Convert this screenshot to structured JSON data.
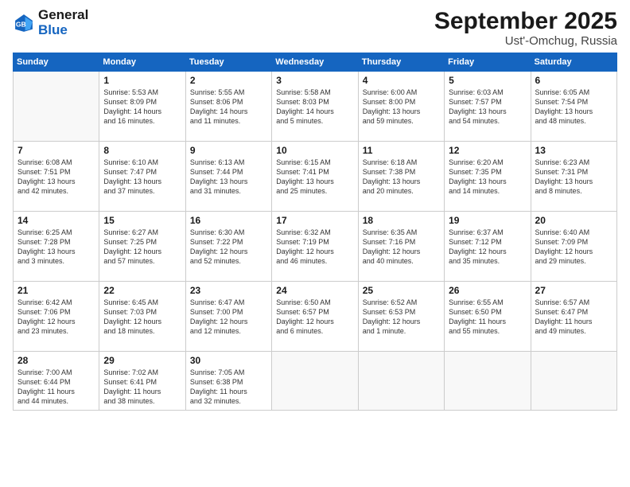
{
  "header": {
    "logo_line1": "General",
    "logo_line2": "Blue",
    "month_title": "September 2025",
    "location": "Ust'-Omchug, Russia"
  },
  "days_of_week": [
    "Sunday",
    "Monday",
    "Tuesday",
    "Wednesday",
    "Thursday",
    "Friday",
    "Saturday"
  ],
  "weeks": [
    [
      {
        "day": "",
        "info": ""
      },
      {
        "day": "1",
        "info": "Sunrise: 5:53 AM\nSunset: 8:09 PM\nDaylight: 14 hours\nand 16 minutes."
      },
      {
        "day": "2",
        "info": "Sunrise: 5:55 AM\nSunset: 8:06 PM\nDaylight: 14 hours\nand 11 minutes."
      },
      {
        "day": "3",
        "info": "Sunrise: 5:58 AM\nSunset: 8:03 PM\nDaylight: 14 hours\nand 5 minutes."
      },
      {
        "day": "4",
        "info": "Sunrise: 6:00 AM\nSunset: 8:00 PM\nDaylight: 13 hours\nand 59 minutes."
      },
      {
        "day": "5",
        "info": "Sunrise: 6:03 AM\nSunset: 7:57 PM\nDaylight: 13 hours\nand 54 minutes."
      },
      {
        "day": "6",
        "info": "Sunrise: 6:05 AM\nSunset: 7:54 PM\nDaylight: 13 hours\nand 48 minutes."
      }
    ],
    [
      {
        "day": "7",
        "info": "Sunrise: 6:08 AM\nSunset: 7:51 PM\nDaylight: 13 hours\nand 42 minutes."
      },
      {
        "day": "8",
        "info": "Sunrise: 6:10 AM\nSunset: 7:47 PM\nDaylight: 13 hours\nand 37 minutes."
      },
      {
        "day": "9",
        "info": "Sunrise: 6:13 AM\nSunset: 7:44 PM\nDaylight: 13 hours\nand 31 minutes."
      },
      {
        "day": "10",
        "info": "Sunrise: 6:15 AM\nSunset: 7:41 PM\nDaylight: 13 hours\nand 25 minutes."
      },
      {
        "day": "11",
        "info": "Sunrise: 6:18 AM\nSunset: 7:38 PM\nDaylight: 13 hours\nand 20 minutes."
      },
      {
        "day": "12",
        "info": "Sunrise: 6:20 AM\nSunset: 7:35 PM\nDaylight: 13 hours\nand 14 minutes."
      },
      {
        "day": "13",
        "info": "Sunrise: 6:23 AM\nSunset: 7:31 PM\nDaylight: 13 hours\nand 8 minutes."
      }
    ],
    [
      {
        "day": "14",
        "info": "Sunrise: 6:25 AM\nSunset: 7:28 PM\nDaylight: 13 hours\nand 3 minutes."
      },
      {
        "day": "15",
        "info": "Sunrise: 6:27 AM\nSunset: 7:25 PM\nDaylight: 12 hours\nand 57 minutes."
      },
      {
        "day": "16",
        "info": "Sunrise: 6:30 AM\nSunset: 7:22 PM\nDaylight: 12 hours\nand 52 minutes."
      },
      {
        "day": "17",
        "info": "Sunrise: 6:32 AM\nSunset: 7:19 PM\nDaylight: 12 hours\nand 46 minutes."
      },
      {
        "day": "18",
        "info": "Sunrise: 6:35 AM\nSunset: 7:16 PM\nDaylight: 12 hours\nand 40 minutes."
      },
      {
        "day": "19",
        "info": "Sunrise: 6:37 AM\nSunset: 7:12 PM\nDaylight: 12 hours\nand 35 minutes."
      },
      {
        "day": "20",
        "info": "Sunrise: 6:40 AM\nSunset: 7:09 PM\nDaylight: 12 hours\nand 29 minutes."
      }
    ],
    [
      {
        "day": "21",
        "info": "Sunrise: 6:42 AM\nSunset: 7:06 PM\nDaylight: 12 hours\nand 23 minutes."
      },
      {
        "day": "22",
        "info": "Sunrise: 6:45 AM\nSunset: 7:03 PM\nDaylight: 12 hours\nand 18 minutes."
      },
      {
        "day": "23",
        "info": "Sunrise: 6:47 AM\nSunset: 7:00 PM\nDaylight: 12 hours\nand 12 minutes."
      },
      {
        "day": "24",
        "info": "Sunrise: 6:50 AM\nSunset: 6:57 PM\nDaylight: 12 hours\nand 6 minutes."
      },
      {
        "day": "25",
        "info": "Sunrise: 6:52 AM\nSunset: 6:53 PM\nDaylight: 12 hours\nand 1 minute."
      },
      {
        "day": "26",
        "info": "Sunrise: 6:55 AM\nSunset: 6:50 PM\nDaylight: 11 hours\nand 55 minutes."
      },
      {
        "day": "27",
        "info": "Sunrise: 6:57 AM\nSunset: 6:47 PM\nDaylight: 11 hours\nand 49 minutes."
      }
    ],
    [
      {
        "day": "28",
        "info": "Sunrise: 7:00 AM\nSunset: 6:44 PM\nDaylight: 11 hours\nand 44 minutes."
      },
      {
        "day": "29",
        "info": "Sunrise: 7:02 AM\nSunset: 6:41 PM\nDaylight: 11 hours\nand 38 minutes."
      },
      {
        "day": "30",
        "info": "Sunrise: 7:05 AM\nSunset: 6:38 PM\nDaylight: 11 hours\nand 32 minutes."
      },
      {
        "day": "",
        "info": ""
      },
      {
        "day": "",
        "info": ""
      },
      {
        "day": "",
        "info": ""
      },
      {
        "day": "",
        "info": ""
      }
    ]
  ]
}
